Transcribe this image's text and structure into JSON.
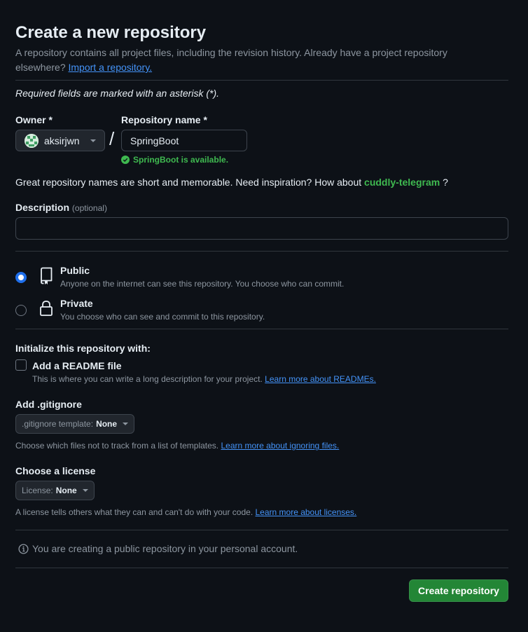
{
  "header": {
    "title": "Create a new repository",
    "subtitle": "A repository contains all project files, including the revision history. Already have a project repository elsewhere?",
    "import_link": "Import a repository."
  },
  "required_note": "Required fields are marked with an asterisk (*).",
  "owner": {
    "label": "Owner *",
    "value": "aksirjwn"
  },
  "repo_name": {
    "label": "Repository name *",
    "value": "SpringBoot",
    "availability": "SpringBoot is available."
  },
  "inspiration": {
    "text": "Great repository names are short and memorable. Need inspiration? How about",
    "suggestion": "cuddly-telegram",
    "suffix": "?"
  },
  "description": {
    "label": "Description",
    "optional": "(optional)",
    "value": ""
  },
  "visibility": {
    "selected": "public",
    "options": [
      {
        "id": "public",
        "title": "Public",
        "description": "Anyone on the internet can see this repository. You choose who can commit.",
        "icon": "repo-icon"
      },
      {
        "id": "private",
        "title": "Private",
        "description": "You choose who can see and commit to this repository.",
        "icon": "lock-icon"
      }
    ]
  },
  "initialize": {
    "heading": "Initialize this repository with:",
    "readme_label": "Add a README file",
    "readme_checked": false,
    "readme_desc": "This is where you can write a long description for your project.",
    "readme_link": "Learn more about READMEs."
  },
  "gitignore": {
    "heading": "Add .gitignore",
    "select_prefix": ".gitignore template:",
    "select_value": "None",
    "desc": "Choose which files not to track from a list of templates.",
    "link": "Learn more about ignoring files."
  },
  "license": {
    "heading": "Choose a license",
    "select_prefix": "License:",
    "select_value": "None",
    "desc": "A license tells others what they can and can't do with your code.",
    "link": "Learn more about licenses."
  },
  "info_message": "You are creating a public repository in your personal account.",
  "submit_label": "Create repository",
  "colors": {
    "background": "#0d1117",
    "accent_green": "#238636",
    "success_text": "#3fb950",
    "link": "#4493f8",
    "radio_selected": "#1f6feb"
  }
}
